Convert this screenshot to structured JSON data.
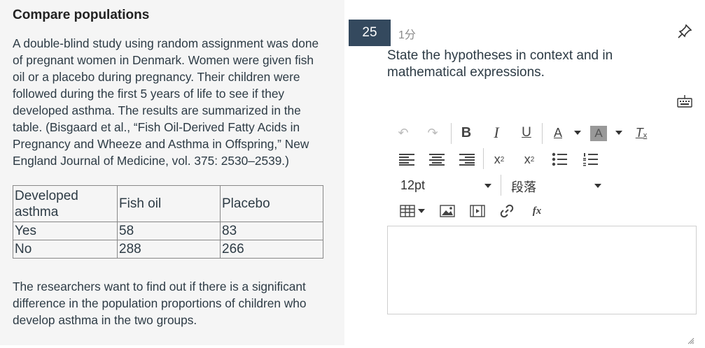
{
  "passage": {
    "title": "Compare populations",
    "intro": "A double-blind study using random assignment was done of pregnant women in Denmark. Women were given fish oil or a placebo during pregnancy. Their children were followed during the first 5 years of life to see if they developed asthma. The results are summarized in the table. (Bisgaard et al., “Fish Oil-Derived Fatty Acids in Pregnancy and Wheeze and Asthma in Offspring,” New England Journal of Medicine, vol. 375: 2530–2539.)",
    "table": {
      "headers": [
        "Developed asthma",
        "Fish oil",
        "Placebo"
      ],
      "rows": [
        [
          "Yes",
          "58",
          "83"
        ],
        [
          "No",
          "288",
          "266"
        ]
      ]
    },
    "followup": "The researchers want to find out if there is a significant difference in the population proportions of children who develop asthma in the two groups."
  },
  "question": {
    "number": "25",
    "points": "1分",
    "prompt": "State the hypotheses in context and in mathematical expressions."
  },
  "toolbar": {
    "font_size": "12pt",
    "paragraph": "段落"
  },
  "editor": {
    "value": ""
  },
  "colors": {
    "question_badge": "#34495e",
    "left_panel": "#f5f5f5"
  }
}
